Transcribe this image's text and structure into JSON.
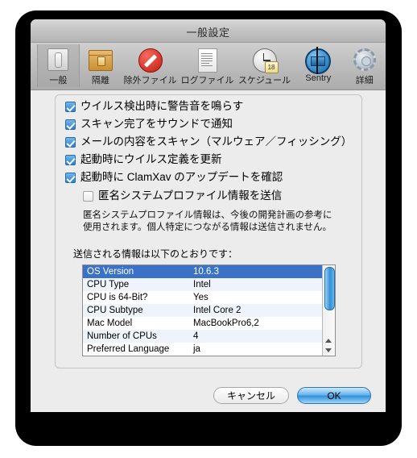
{
  "window": {
    "title": "一般設定"
  },
  "toolbar": {
    "items": [
      {
        "label": "一般",
        "icon": "switch-icon",
        "selected": true
      },
      {
        "label": "隔離",
        "icon": "box-lock-icon",
        "selected": false
      },
      {
        "label": "除外ファイル",
        "icon": "deny-icon",
        "selected": false
      },
      {
        "label": "ログファイル",
        "icon": "document-icon",
        "selected": false
      },
      {
        "label": "スケジュール",
        "icon": "clock-calendar-icon",
        "selected": false
      },
      {
        "label": "Sentry",
        "icon": "sentry-icon",
        "selected": false
      },
      {
        "label": "詳細",
        "icon": "gear-icon",
        "selected": false
      }
    ],
    "calendar_day": "18"
  },
  "options": [
    {
      "label": "ウイルス検出時に警告音を鳴らす",
      "checked": true,
      "indent": false
    },
    {
      "label": "スキャン完了をサウンドで通知",
      "checked": true,
      "indent": false
    },
    {
      "label": "メールの内容をスキャン（マルウェア／フィッシング）",
      "checked": true,
      "indent": false
    },
    {
      "label": "起動時にウイルス定義を更新",
      "checked": true,
      "indent": false
    },
    {
      "label": "起動時に ClamXav のアップデートを確認",
      "checked": true,
      "indent": false
    },
    {
      "label": "匿名システムプロファイル情報を送信",
      "checked": false,
      "indent": true
    }
  ],
  "note": "匿名システムプロファイル情報は、今後の開発計画の参考に使用されます。個人特定につながる情報は送信されません。",
  "list_label": "送信される情報は以下のとおりです：",
  "profile_table": {
    "rows": [
      {
        "key": "OS Version",
        "value": "10.6.3",
        "selected": true
      },
      {
        "key": "CPU Type",
        "value": "Intel",
        "selected": false
      },
      {
        "key": "CPU is 64-Bit?",
        "value": "Yes",
        "selected": false
      },
      {
        "key": "CPU Subtype",
        "value": "Intel Core 2",
        "selected": false
      },
      {
        "key": "Mac Model",
        "value": "MacBookPro6,2",
        "selected": false
      },
      {
        "key": "Number of CPUs",
        "value": "4",
        "selected": false
      },
      {
        "key": "Preferred Language",
        "value": "ja",
        "selected": false
      }
    ]
  },
  "buttons": {
    "cancel": "キャンセル",
    "ok": "OK"
  },
  "colors": {
    "accent": "#2f8fdc",
    "selection": "#3a72c8",
    "window_bg": "#ececec"
  }
}
